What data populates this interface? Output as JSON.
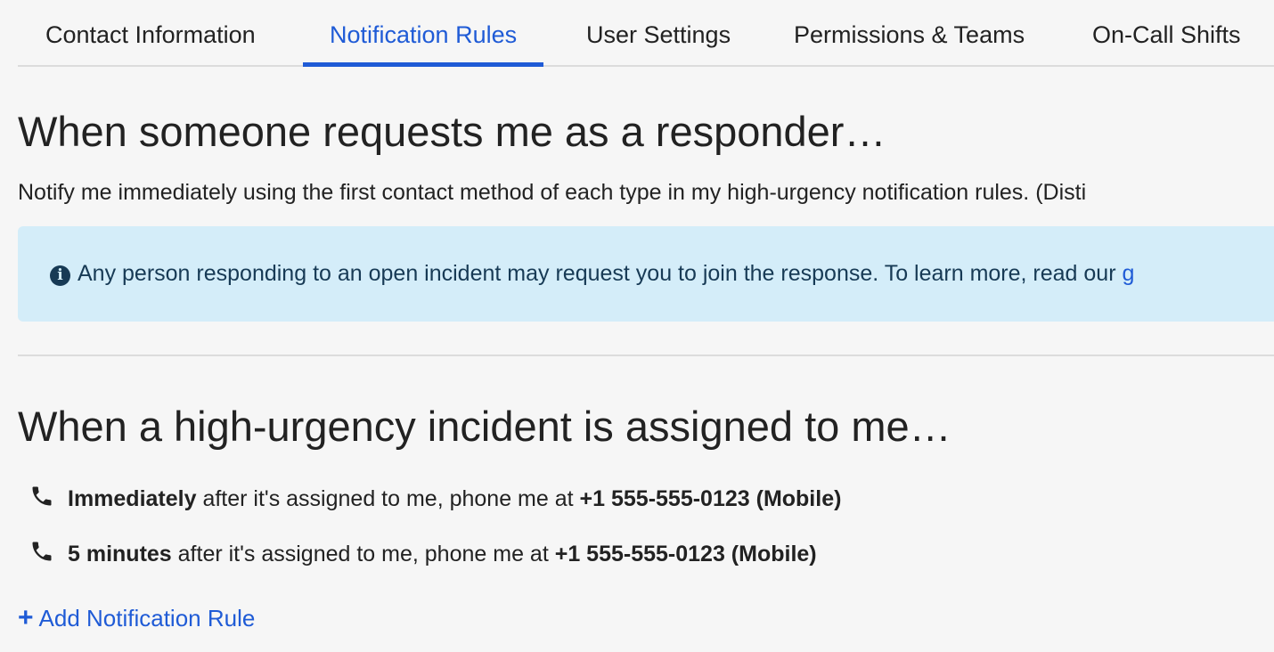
{
  "tabs": [
    {
      "label": "Contact Information",
      "active": false
    },
    {
      "label": "Notification Rules",
      "active": true
    },
    {
      "label": "User Settings",
      "active": false
    },
    {
      "label": "Permissions & Teams",
      "active": false
    },
    {
      "label": "On-Call Shifts",
      "active": false
    }
  ],
  "responder_section": {
    "heading": "When someone requests me as a responder…",
    "description": "Notify me immediately using the first contact method of each type in my high-urgency notification rules. (Disti",
    "alert": {
      "text": "Any person responding to an open incident may request you to join the response. To learn more, read our ",
      "link_text": "g"
    }
  },
  "high_urgency_section": {
    "heading": "When a high-urgency incident is assigned to me…",
    "rules": [
      {
        "delay": "Immediately",
        "middle": " after it's assigned to me, phone me at ",
        "contact": "+1 555-555-0123 (Mobile)"
      },
      {
        "delay": "5 minutes",
        "middle": " after it's assigned to me, phone me at ",
        "contact": "+1 555-555-0123 (Mobile)"
      }
    ],
    "add_rule_label": "Add Notification Rule"
  },
  "icons": {
    "info": "info-icon",
    "phone": "phone-icon",
    "plus": "plus-icon"
  },
  "colors": {
    "accent": "#1f5bd6",
    "alert_background": "#d4edf9",
    "alert_text": "#173a55",
    "page_background": "#f6f6f6"
  }
}
